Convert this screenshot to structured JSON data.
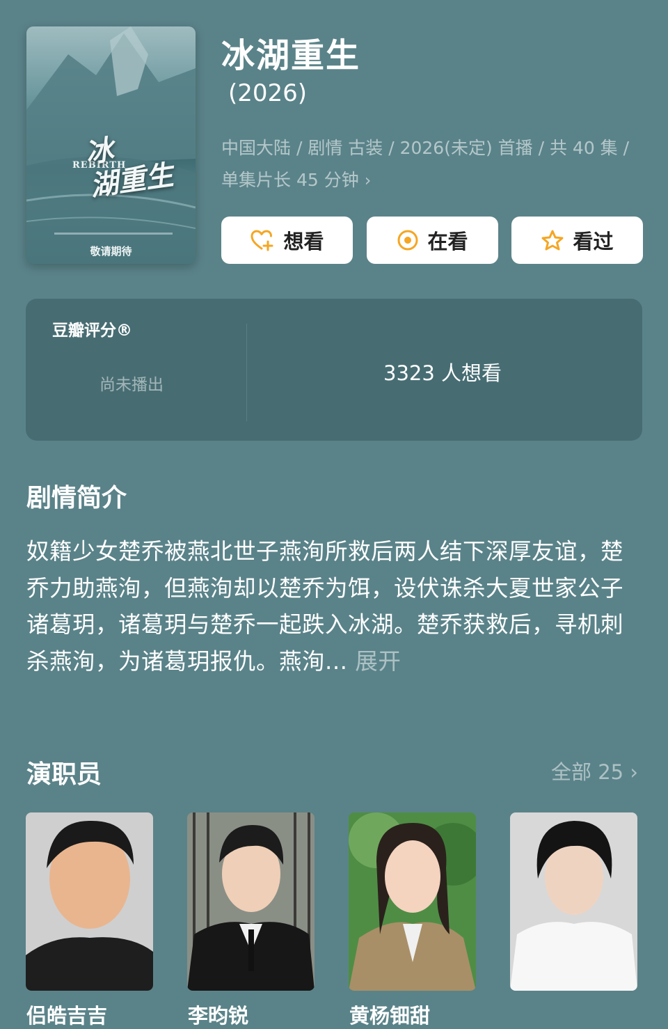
{
  "poster": {
    "title": "冰\n湖重生",
    "english": "REBIRTH",
    "tagline": "敬请期待"
  },
  "title": "冰湖重生",
  "year": "(2026)",
  "meta": {
    "line1": "中国大陆 / 剧情 古装 / 2026(未定) 首播 / 共 40 集 /",
    "line2": "单集片长 45 分钟"
  },
  "actions": {
    "want": "想看",
    "watching": "在看",
    "watched": "看过"
  },
  "rating": {
    "label": "豆瓣评分®",
    "status": "尚未播出",
    "want_count": "3323 人想看"
  },
  "synopsis": {
    "title": "剧情简介",
    "text": "奴籍少女楚乔被燕北世子燕洵所救后两人结下深厚友谊，楚乔力助燕洵，但燕洵却以楚乔为饵，设伏诛杀大夏世家公子诸葛玥，诸葛玥与楚乔一起跌入冰湖。楚乔获救后，寻机刺杀燕洵，为诸葛玥报仇。燕洵...",
    "more": "展开"
  },
  "cast": {
    "title": "演职员",
    "all_label": "全部 25",
    "members": [
      {
        "name": "侣皓吉吉"
      },
      {
        "name": "李昀锐"
      },
      {
        "name": "黄杨钿甜"
      },
      {
        "name": ""
      }
    ]
  },
  "colors": {
    "background": "#5a8389",
    "card": "#476d73",
    "accent_orange": "#f5a623"
  }
}
